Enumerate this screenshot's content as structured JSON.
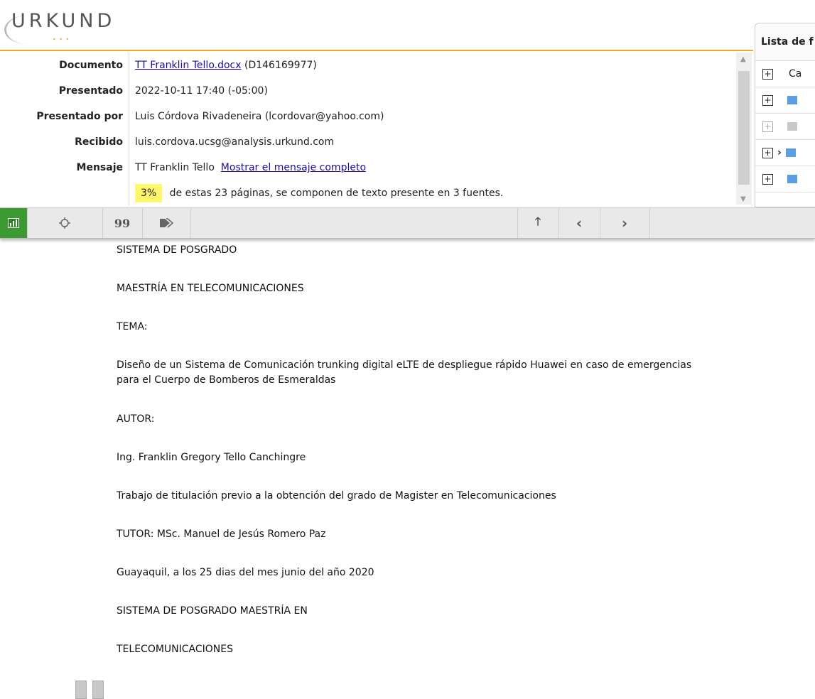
{
  "app": {
    "logo": "URKUND"
  },
  "info": {
    "rows": [
      {
        "label": "Documento",
        "link": "TT Franklin Tello.docx",
        "value": "(D146169977)"
      },
      {
        "label": "Presentado",
        "value": "2022-10-11 17:40 (-05:00)"
      },
      {
        "label": "Presentado por",
        "value": "Luis Córdova Rivadeneira (lcordovar@yahoo.com)"
      },
      {
        "label": "Recibido",
        "value": "luis.cordova.ucsg@analysis.urkund.com"
      },
      {
        "label": "Mensaje",
        "value": "TT Franklin Tello",
        "link": "Mostrar el mensaje completo"
      }
    ],
    "percentage": "3%",
    "summary": "de estas 23 páginas, se componen de texto presente en 3 fuentes."
  },
  "sources": {
    "title": "Lista de f",
    "column": "Ca"
  },
  "toolbar": {
    "buttons": [
      "chart-icon",
      "target-icon",
      "quote-icon",
      "tags-icon",
      "arrow-up-icon",
      "chevron-left-icon",
      "chevron-right-icon"
    ],
    "quote_glyph": "99"
  },
  "document": {
    "paragraphs": [
      "SISTEMA DE POSGRADO",
      "MAESTRÍA EN TELECOMUNICACIONES",
      "TEMA:",
      "Diseño de un Sistema de Comunicación trunking digital eLTE de despliegue rápido Huawei en caso de emergencias para el Cuerpo de Bomberos de Esmeraldas",
      "AUTOR:",
      "Ing. Franklin Gregory Tello Canchingre",
      "Trabajo de titulación previo a la obtención del grado de Magister en Telecomunicaciones",
      "TUTOR: MSc. Manuel de Jesús Romero Paz",
      "Guayaquil, a los 25 dias del mes junio del año 2020",
      "SISTEMA DE POSGRADO MAESTRÍA EN",
      "TELECOMUNICACIONES"
    ]
  },
  "colors": {
    "accent": "#f5a623",
    "active_tool": "#3c9a33",
    "highlight": "#fff66a",
    "link": "#1a0dab"
  }
}
